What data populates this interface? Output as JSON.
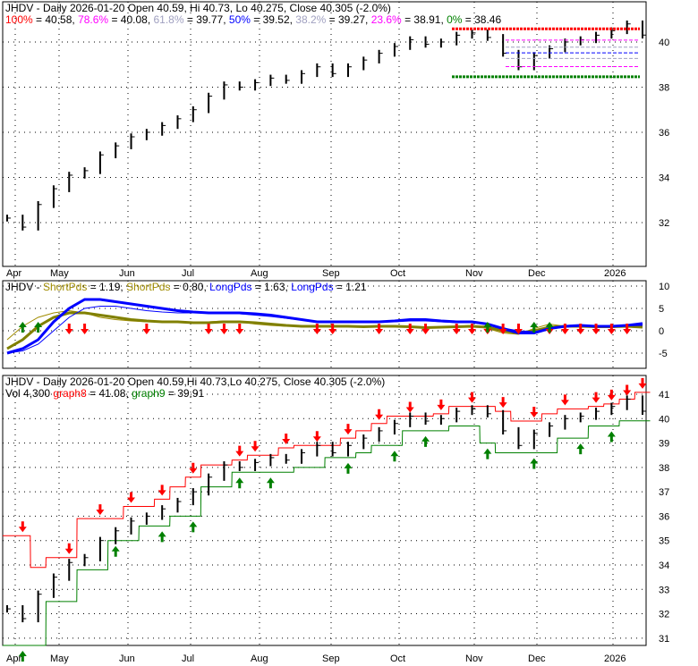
{
  "colors": {
    "red": "#ff0000",
    "magenta": "#ff00ff",
    "gray": "#a0a0c0",
    "blue": "#0000ff",
    "green": "#008000",
    "olive": "#a08c00",
    "olive2": "#808000"
  },
  "chart_data": [
    {
      "type": "bar",
      "name": "price-fib",
      "title_prefix": "JHDV - Daily 2026-01-20 Open 40.59, Hi 40.73, Lo 40.275, Close 40.305 (-2.0%)",
      "fib": [
        {
          "label": "100%",
          "value": 40.58,
          "text": " = 40.58, ",
          "color": "#ff0000"
        },
        {
          "label": "78.6%",
          "value": 40.08,
          "text": " = 40.08, ",
          "color": "#ff00ff"
        },
        {
          "label": "61.8%",
          "value": 39.77,
          "text": " = 39.77, ",
          "color": "#a0a0c0"
        },
        {
          "label": "50%",
          "value": 39.52,
          "text": " = 39.52, ",
          "color": "#0000ff"
        },
        {
          "label": "38.2%",
          "value": 39.27,
          "text": " = 39.27, ",
          "color": "#a0a0c0"
        },
        {
          "label": "23.6%",
          "value": 38.91,
          "text": " = 38.91, ",
          "color": "#ff00ff"
        },
        {
          "label": "0%",
          "value": 38.46,
          "text": " = 38.46",
          "color": "#008000"
        }
      ],
      "yticks": [
        32,
        34,
        36,
        38,
        40
      ],
      "ylim": [
        30.06,
        41.78
      ],
      "xticks": [
        "Apr",
        "May",
        "Jun",
        "Jul",
        "Aug",
        "Sep",
        "Oct",
        "Nov",
        "Dec",
        "2026"
      ],
      "closes": [
        32.2,
        31.8,
        32.8,
        33.5,
        34.1,
        34.3,
        35.0,
        35.4,
        35.8,
        36.0,
        36.3,
        36.6,
        37.0,
        37.6,
        38.1,
        38.0,
        38.2,
        38.4,
        38.3,
        38.6,
        38.9,
        38.6,
        38.9,
        39.2,
        39.5,
        39.8,
        40.1,
        39.9,
        40.0,
        40.3,
        40.4,
        40.2,
        39.5,
        38.9,
        39.4,
        39.7,
        40.0,
        40.1,
        40.3,
        40.5,
        40.8,
        40.305
      ]
    },
    {
      "type": "line",
      "name": "periods",
      "title": "JHDV - ",
      "legend": [
        {
          "label": "ShortPds",
          "text": " = 1.19, ",
          "color": "#a08c00"
        },
        {
          "label": "ShortPds",
          "text": " = 0.80, ",
          "color": "#a08c00"
        },
        {
          "label": "LongPds",
          "text": " = 1.63, ",
          "color": "#0000ff"
        },
        {
          "label": "LongPds",
          "text": " = 1.21",
          "color": "#0000ff"
        }
      ],
      "yticks": [
        10,
        5,
        0,
        -5
      ],
      "ylim": [
        -8.4,
        11.2
      ],
      "series": [
        {
          "name": "ShortPds",
          "values": [
            -2,
            1,
            3,
            4,
            4.5,
            4,
            3,
            2.5,
            2.2,
            2,
            2,
            1.8,
            1.8,
            2,
            2.2,
            2,
            1.5,
            1.2,
            1,
            1,
            0.8,
            1,
            1,
            0.8,
            1.2,
            1,
            0.8,
            0.5,
            0.8,
            1,
            1.2,
            0.5,
            -0.5,
            -0.8,
            0.5,
            1.5,
            1,
            1.2,
            0.8,
            1,
            1.2,
            1.19
          ]
        },
        {
          "name": "ShortPds2",
          "values": [
            -4,
            -2,
            1,
            3,
            4,
            4,
            3.5,
            3,
            2.5,
            2.2,
            2,
            2,
            1.8,
            1.8,
            2,
            2,
            1.8,
            1.5,
            1.2,
            1,
            1,
            1,
            1,
            0.9,
            1,
            1,
            0.9,
            0.7,
            0.8,
            0.9,
            1,
            0.8,
            0,
            -0.5,
            0,
            0.8,
            1,
            1,
            0.9,
            0.9,
            1,
            0.8
          ]
        },
        {
          "name": "LongPds",
          "values": [
            -5,
            -4,
            -2,
            2,
            5,
            7,
            7,
            6.5,
            6,
            5.5,
            5,
            4.5,
            4.2,
            4,
            4,
            4,
            3.8,
            3.5,
            3,
            2.5,
            2,
            2,
            2,
            2,
            2,
            2.2,
            2.5,
            2.5,
            2.2,
            2,
            2,
            1.5,
            0.5,
            -0.5,
            -0.5,
            0.5,
            1,
            1.2,
            1,
            1,
            1.2,
            1.63
          ]
        },
        {
          "name": "LongPds2",
          "values": [
            -5,
            -4.5,
            -3,
            0,
            3,
            5,
            5.5,
            5.5,
            5,
            4.5,
            4.2,
            4,
            4,
            4,
            4,
            3.8,
            3.5,
            3.2,
            2.8,
            2.4,
            2,
            2,
            2,
            2,
            2,
            2,
            2.2,
            2.2,
            2,
            1.8,
            1.8,
            1.4,
            0.6,
            0,
            -0.2,
            0.4,
            0.8,
            1,
            1,
            1,
            1.1,
            1.21
          ]
        }
      ],
      "down_arrows": [
        4,
        5,
        9,
        13,
        14,
        15,
        20,
        21,
        24,
        26,
        27,
        29,
        30,
        31,
        32,
        33,
        35,
        36,
        37,
        38,
        39,
        40
      ],
      "up_arrows": [
        1,
        2,
        31,
        34,
        35
      ]
    },
    {
      "type": "bar",
      "name": "price-bands",
      "title": "JHDV - Daily 2026-01-20 Open 40.59,Hi 40.73,Lo 40.275, Close 40.305 (-2.0%)",
      "vol": "Vol 4,300 ",
      "g8label": "graph8",
      "g8text": " = 41.08, ",
      "g9label": "graph9",
      "g9text": " = 39.91",
      "yticks": [
        31,
        32,
        33,
        34,
        35,
        36,
        37,
        38,
        39,
        40,
        41
      ],
      "ylim": [
        30.7,
        41.77
      ],
      "graph8": [
        35.2,
        35.2,
        33.9,
        34.3,
        34.3,
        35.9,
        35.9,
        35.9,
        36.4,
        36.4,
        36.7,
        37.2,
        37.6,
        38.1,
        38.1,
        38.3,
        38.5,
        38.5,
        38.8,
        38.9,
        38.9,
        38.9,
        39.2,
        39.5,
        39.8,
        40.1,
        40.1,
        40.1,
        40.2,
        40.5,
        40.5,
        40.5,
        40.3,
        39.9,
        39.9,
        40.2,
        40.4,
        40.4,
        40.5,
        40.6,
        40.8,
        41.08
      ],
      "graph9": [
        30.7,
        30.7,
        30.7,
        32.5,
        32.5,
        33.8,
        33.8,
        35.0,
        35.0,
        35.6,
        35.6,
        36.0,
        36.0,
        37.2,
        37.2,
        37.8,
        37.8,
        37.8,
        37.8,
        38.0,
        38.0,
        38.4,
        38.4,
        38.6,
        38.9,
        38.9,
        39.5,
        39.5,
        39.5,
        39.7,
        39.7,
        39.0,
        38.6,
        38.6,
        38.6,
        38.6,
        39.2,
        39.2,
        39.7,
        39.7,
        39.91,
        39.91
      ],
      "down_arrows": [
        1,
        4,
        6,
        8,
        10,
        12,
        15,
        16,
        18,
        20,
        22,
        24,
        26,
        28,
        30,
        32,
        34,
        36,
        38,
        39,
        40,
        41
      ],
      "up_arrows": [
        1,
        7,
        10,
        12,
        15,
        17,
        22,
        25,
        27,
        31,
        34,
        37,
        39
      ]
    }
  ]
}
